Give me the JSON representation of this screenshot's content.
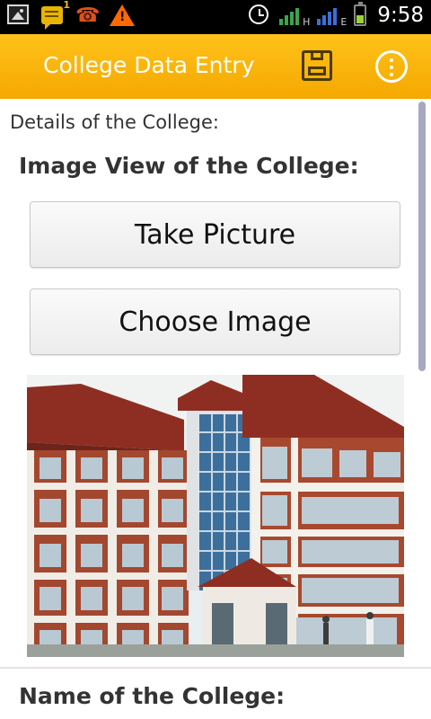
{
  "status_bar": {
    "time": "9:58",
    "message_count": "1",
    "icons": [
      "gallery-icon",
      "message-icon",
      "missed-call-icon",
      "warning-icon",
      "alarm-icon",
      "signal-h-icon",
      "signal-e-icon",
      "battery-icon"
    ],
    "network_labels": [
      "H",
      "E"
    ]
  },
  "action_bar": {
    "title": "College Data Entry",
    "save_icon": "save-icon",
    "overflow_icon": "overflow-menu-icon",
    "color": "#f8b400"
  },
  "form": {
    "section_label": "Details of the College:",
    "image_heading": "Image View of the College:",
    "take_picture_label": "Take Picture",
    "choose_image_label": "Choose Image",
    "name_heading": "Name of the College:"
  }
}
